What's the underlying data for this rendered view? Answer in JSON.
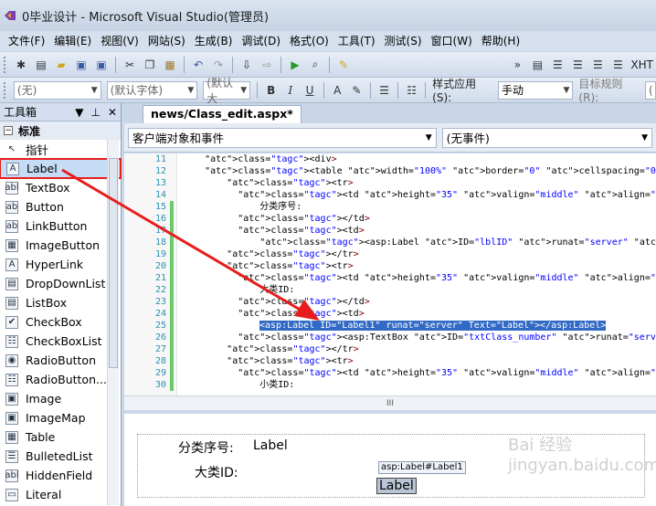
{
  "window": {
    "title": "0毕业设计 - Microsoft Visual Studio(管理员)"
  },
  "menu": [
    "文件(F)",
    "编辑(E)",
    "视图(V)",
    "网站(S)",
    "生成(B)",
    "调试(D)",
    "格式(O)",
    "工具(T)",
    "测试(S)",
    "窗口(W)",
    "帮助(H)"
  ],
  "toolbar2": {
    "style_combo": "(无)",
    "font_combo": "(默认字体)",
    "size_combo": "(默认大",
    "bold": "B",
    "italic": "I",
    "underline": "U",
    "style_apply_label": "样式应用(S):",
    "style_apply_value": "手动",
    "target_rule_label": "目标规则(R):",
    "target_rule_value": "(",
    "xhtml": "XHT"
  },
  "toolbox": {
    "title": "工具箱",
    "pin": "▼ 𝟒 ✕",
    "category": "标准",
    "items": [
      {
        "label": "指针",
        "icon": "↖"
      },
      {
        "label": "Label",
        "icon": "A"
      },
      {
        "label": "TextBox",
        "icon": "abl"
      },
      {
        "label": "Button",
        "icon": "ab"
      },
      {
        "label": "LinkButton",
        "icon": "ab"
      },
      {
        "label": "ImageButton",
        "icon": "▦"
      },
      {
        "label": "HyperLink",
        "icon": "A"
      },
      {
        "label": "DropDownList",
        "icon": "▤"
      },
      {
        "label": "ListBox",
        "icon": "▤"
      },
      {
        "label": "CheckBox",
        "icon": "✔"
      },
      {
        "label": "CheckBoxList",
        "icon": "☷"
      },
      {
        "label": "RadioButton",
        "icon": "◉"
      },
      {
        "label": "RadioButton...",
        "icon": "☷"
      },
      {
        "label": "Image",
        "icon": "▣"
      },
      {
        "label": "ImageMap",
        "icon": "▣"
      },
      {
        "label": "Table",
        "icon": "▦"
      },
      {
        "label": "BulletedList",
        "icon": "☰"
      },
      {
        "label": "HiddenField",
        "icon": "abl"
      },
      {
        "label": "Literal",
        "icon": "▭"
      }
    ]
  },
  "editor": {
    "tab": "news/Class_edit.aspx*",
    "client_objects": "客户端对象和事件",
    "events": "(无事件)",
    "lines": [
      {
        "n": "11",
        "code": "    <div>"
      },
      {
        "n": "12",
        "code": "    <table width=\"100%\" border=\"0\" cellspacing=\"0\" cellpadding=\"0\">"
      },
      {
        "n": "13",
        "code": "        <tr>"
      },
      {
        "n": "14",
        "code": "          <td height=\"35\" valign=\"middle\" align=\"right\">"
      },
      {
        "n": "15",
        "code": "              分类序号:"
      },
      {
        "n": "16",
        "code": "          </td>"
      },
      {
        "n": "17",
        "code": "          <td>"
      },
      {
        "n": "18",
        "code": "              <asp:Label ID=\"lblID\" runat=\"server\" Text=\"Label\"></asp:Label></td>"
      },
      {
        "n": "19",
        "code": "        </tr>"
      },
      {
        "n": "20",
        "code": "        <tr>"
      },
      {
        "n": "21",
        "code": "          <td height=\"35\" valign=\"middle\" align=\"right\">"
      },
      {
        "n": "22",
        "code": "              大类ID:"
      },
      {
        "n": "23",
        "code": "          </td>"
      },
      {
        "n": "24",
        "code": "          <td>"
      },
      {
        "n": "25",
        "code": "              <asp:Label ID=\"Label1\" runat=\"server\" Text=\"Label\"></asp:Label>"
      },
      {
        "n": "26",
        "code": "          <asp:TextBox ID=\"txtClass_number\" runat=\"server\" Width=\"300px\"></asp:TextBox"
      },
      {
        "n": "27",
        "code": "        </tr>"
      },
      {
        "n": "28",
        "code": "        <tr>"
      },
      {
        "n": "29",
        "code": "          <td height=\"35\" valign=\"middle\" align=\"right\">"
      },
      {
        "n": "30",
        "code": "              小类ID:"
      }
    ],
    "hscroll": "III"
  },
  "design": {
    "row1_label": "分类序号:",
    "row1_value": "Label",
    "row2_label": "大类ID:",
    "tooltip": "asp:Label#Label1",
    "selected_label": "Label"
  },
  "watermark": "Bai 经验 jingyan.baidu.com",
  "colors": {
    "annotation": "#e81d1d",
    "selection": "#316ac5"
  }
}
